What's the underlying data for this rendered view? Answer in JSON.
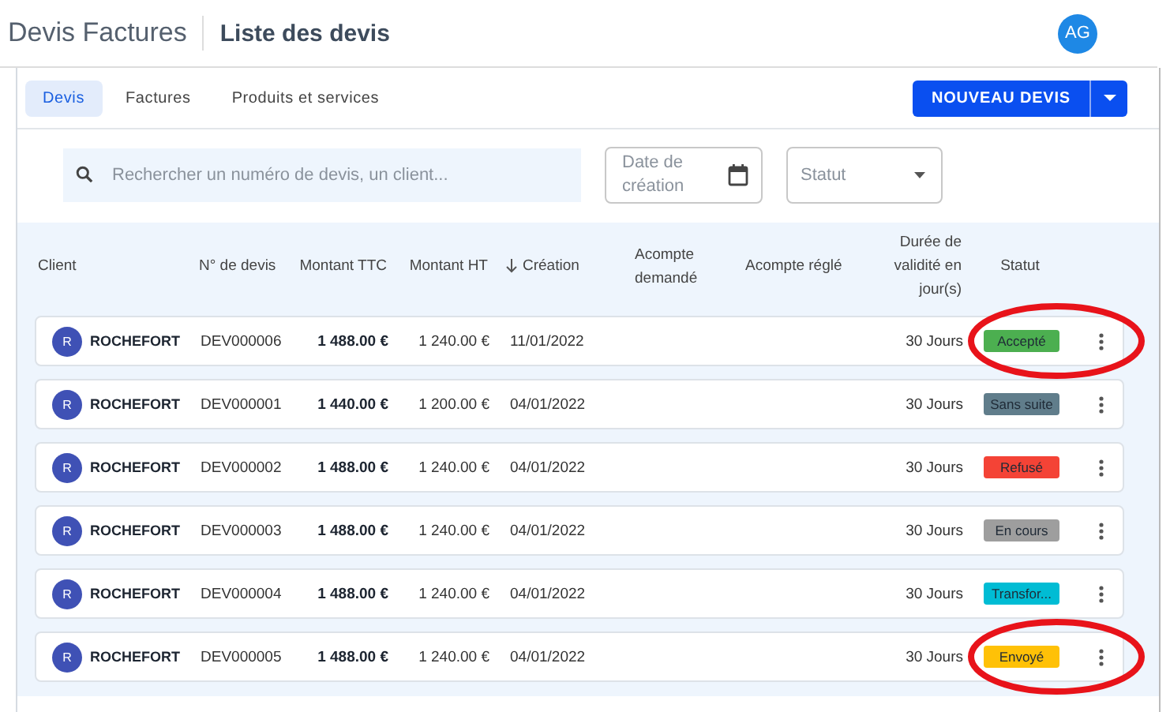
{
  "header": {
    "app_title": "Devis Factures",
    "page_title": "Liste des devis",
    "avatar": "AG"
  },
  "tabs": [
    {
      "label": "Devis",
      "selected": true
    },
    {
      "label": "Factures",
      "selected": false
    },
    {
      "label": "Produits et services",
      "selected": false
    }
  ],
  "new_button": {
    "label": "NOUVEAU DEVIS"
  },
  "filters": {
    "search": {
      "placeholder": "Rechercher un numéro de devis, un client..."
    },
    "date": {
      "placeholder": "Date de création"
    },
    "status": {
      "placeholder": "Statut"
    }
  },
  "table": {
    "columns": [
      {
        "label": "Client",
        "sorted": false
      },
      {
        "label": "N° de devis",
        "sorted": false
      },
      {
        "label": "Montant TTC",
        "sorted": false
      },
      {
        "label": "Montant HT",
        "sorted": false
      },
      {
        "label": "Création",
        "sorted": true
      },
      {
        "label": "Acompte demandé",
        "sorted": false
      },
      {
        "label": "Acompte réglé",
        "sorted": false
      },
      {
        "label": "Durée de validité en jour(s)",
        "sorted": false
      },
      {
        "label": "Statut",
        "sorted": false
      }
    ],
    "rows": [
      {
        "initial": "R",
        "client": "ROCHEFORT",
        "number": "DEV000006",
        "ttc": "1 488.00 €",
        "ht": "1 240.00 €",
        "created": "11/01/2022",
        "duration": "30 Jours",
        "status": "Accepté",
        "color": "#4caf50",
        "circled": true
      },
      {
        "initial": "R",
        "client": "ROCHEFORT",
        "number": "DEV000001",
        "ttc": "1 440.00 €",
        "ht": "1 200.00 €",
        "created": "04/01/2022",
        "duration": "30 Jours",
        "status": "Sans suite",
        "color": "#607d8b",
        "circled": false
      },
      {
        "initial": "R",
        "client": "ROCHEFORT",
        "number": "DEV000002",
        "ttc": "1 488.00 €",
        "ht": "1 240.00 €",
        "created": "04/01/2022",
        "duration": "30 Jours",
        "status": "Refusé",
        "color": "#f44336",
        "circled": false
      },
      {
        "initial": "R",
        "client": "ROCHEFORT",
        "number": "DEV000003",
        "ttc": "1 488.00 €",
        "ht": "1 240.00 €",
        "created": "04/01/2022",
        "duration": "30 Jours",
        "status": "En cours",
        "color": "#9e9e9e",
        "circled": false
      },
      {
        "initial": "R",
        "client": "ROCHEFORT",
        "number": "DEV000004",
        "ttc": "1 488.00 €",
        "ht": "1 240.00 €",
        "created": "04/01/2022",
        "duration": "30 Jours",
        "status": "Transfor...",
        "color": "#00bcd4",
        "circled": false
      },
      {
        "initial": "R",
        "client": "ROCHEFORT",
        "number": "DEV000005",
        "ttc": "1 488.00 €",
        "ht": "1 240.00 €",
        "created": "04/01/2022",
        "duration": "30 Jours",
        "status": "Envoyé",
        "color": "#ffc107",
        "circled": true
      }
    ]
  }
}
